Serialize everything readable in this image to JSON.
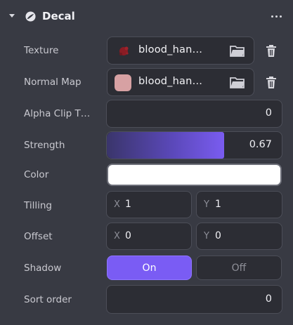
{
  "header": {
    "title": "Decal",
    "icon": "decal-icon"
  },
  "texture": {
    "label": "Texture",
    "asset": "blood_han…",
    "thumb_color": "#8a1c24"
  },
  "normal_map": {
    "label": "Normal Map",
    "asset": "blood_han…",
    "thumb_color": "#d7a1a3"
  },
  "alpha_clip": {
    "label": "Alpha Clip T…",
    "value": "0"
  },
  "strength": {
    "label": "Strength",
    "value": "0.67",
    "fraction": 0.67
  },
  "color": {
    "label": "Color",
    "value": "#ffffff"
  },
  "tilling": {
    "label": "Tilling",
    "x_axis": "X",
    "x": "1",
    "y_axis": "Y",
    "y": "1"
  },
  "offset": {
    "label": "Offset",
    "x_axis": "X",
    "x": "0",
    "y_axis": "Y",
    "y": "0"
  },
  "shadow": {
    "label": "Shadow",
    "on": "On",
    "off": "Off",
    "selected": "On"
  },
  "sort_order": {
    "label": "Sort order",
    "value": "0"
  },
  "colors": {
    "accent": "#7a5cf4",
    "panel": "#383a43",
    "field": "#2c2d34"
  }
}
